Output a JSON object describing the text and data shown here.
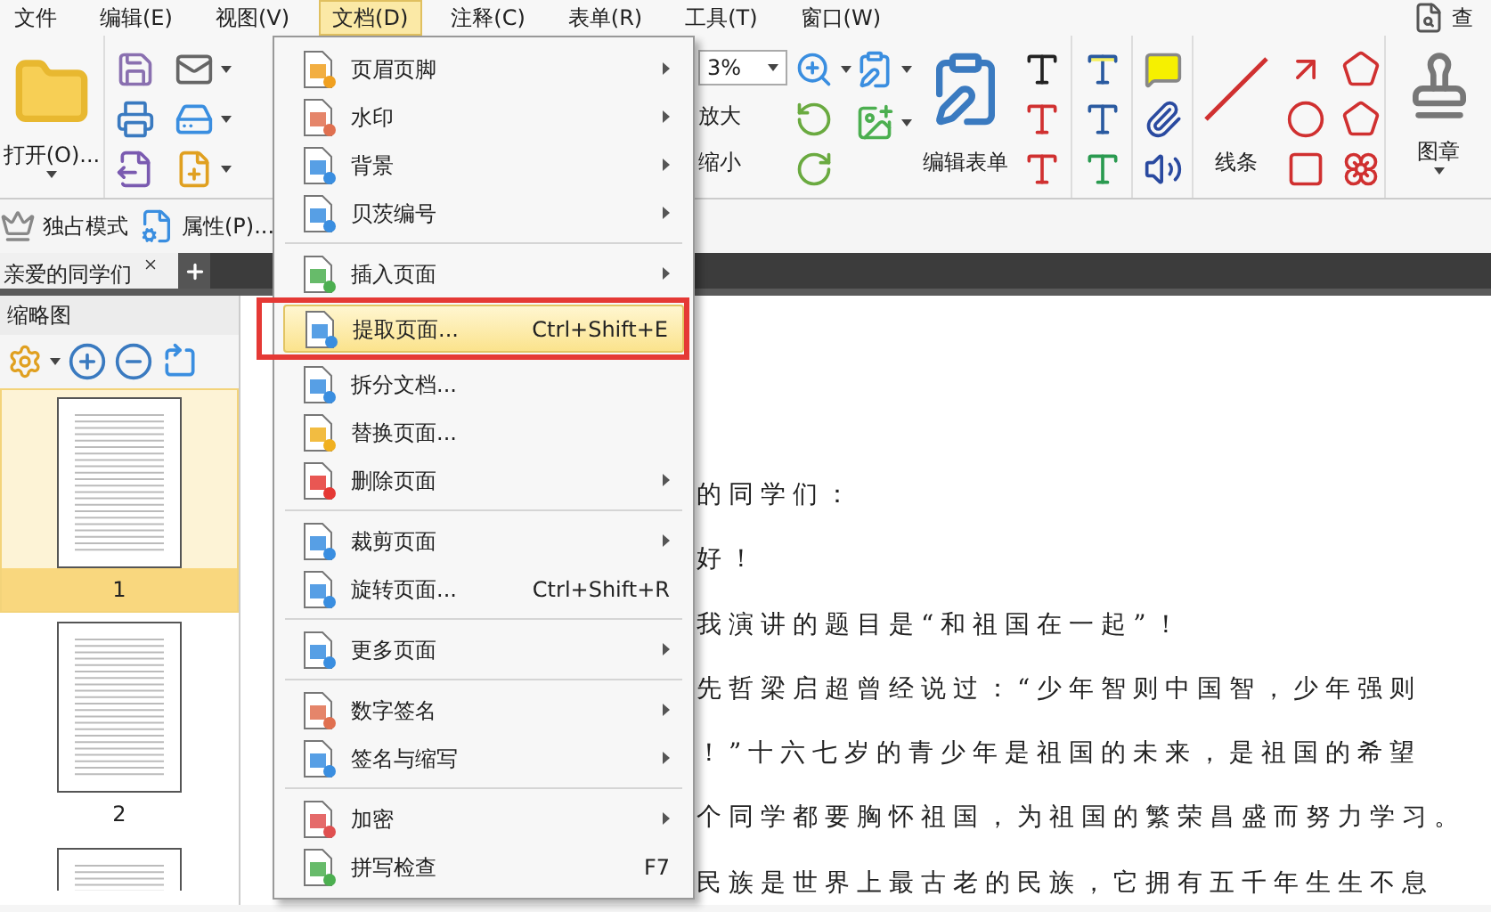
{
  "menu_bar": [
    {
      "label": "文件",
      "selected": false
    },
    {
      "label": "编辑(E)",
      "selected": false
    },
    {
      "label": "视图(V)",
      "selected": false
    },
    {
      "label": "文档(D)",
      "selected": true
    },
    {
      "label": "注释(C)",
      "selected": false
    },
    {
      "label": "表单(R)",
      "selected": false
    },
    {
      "label": "工具(T)",
      "selected": false
    },
    {
      "label": "窗口(W)",
      "selected": false
    }
  ],
  "find": {
    "label": "查"
  },
  "ribbon": {
    "open_label": "打开(O)...",
    "zoom_value": "3%",
    "zoom_in": "放大",
    "zoom_out": "缩小",
    "edit_form": "编辑表单",
    "line": "线条",
    "stamp": "图章"
  },
  "quick_bar": [
    {
      "label": "独占模式"
    },
    {
      "label": "属性(P)..."
    }
  ],
  "tabs": [
    {
      "label": "亲爱的同学们",
      "selected": true
    }
  ],
  "thumbnail_panel": {
    "title": "缩略图",
    "pages": [
      {
        "label": "1",
        "selected": true
      },
      {
        "label": "2",
        "selected": false
      }
    ],
    "partial_page": true
  },
  "document": {
    "lines": [
      "的同学们：",
      "好！",
      "我演讲的题目是“和祖国在一起”！",
      "先哲梁启超曾经说过：“少年智则中国智，少年强则",
      "！”十六七岁的青少年是祖国的未来，是祖国的希望",
      "个同学都要胸怀祖国，为祖国的繁荣昌盛而努力学习。",
      "民族是世界上最古老的民族，它拥有五千年生生不息"
    ]
  },
  "menu": {
    "groups": [
      {
        "items": [
          {
            "label": "页眉页脚",
            "submenu": true,
            "selected": false,
            "outlined": false
          },
          {
            "label": "水印",
            "submenu": true,
            "selected": false,
            "outlined": false
          },
          {
            "label": "背景",
            "submenu": true,
            "selected": false,
            "outlined": false
          },
          {
            "label": "贝茨编号",
            "submenu": true,
            "selected": false,
            "outlined": false
          }
        ]
      },
      {
        "items": [
          {
            "label": "插入页面",
            "submenu": true,
            "selected": false,
            "outlined": false
          },
          {
            "label": "提取页面...",
            "shortcut": "Ctrl+Shift+E",
            "submenu": false,
            "selected": true,
            "outlined": true
          },
          {
            "label": "拆分文档...",
            "submenu": false,
            "selected": false,
            "outlined": false
          },
          {
            "label": "替换页面...",
            "submenu": false,
            "selected": false,
            "outlined": false
          },
          {
            "label": "删除页面",
            "submenu": true,
            "selected": false,
            "outlined": false
          }
        ]
      },
      {
        "items": [
          {
            "label": "裁剪页面",
            "submenu": true,
            "selected": false,
            "outlined": false
          },
          {
            "label": "旋转页面...",
            "shortcut": "Ctrl+Shift+R",
            "submenu": false,
            "selected": false,
            "outlined": false
          }
        ]
      },
      {
        "items": [
          {
            "label": "更多页面",
            "submenu": true,
            "selected": false,
            "outlined": false
          }
        ]
      },
      {
        "items": [
          {
            "label": "数字签名",
            "submenu": true,
            "selected": false,
            "outlined": false
          },
          {
            "label": "签名与缩写",
            "submenu": true,
            "selected": false,
            "outlined": false
          }
        ]
      },
      {
        "items": [
          {
            "label": "加密",
            "submenu": true,
            "selected": false,
            "outlined": false
          },
          {
            "label": "拼写检查",
            "shortcut": "F7",
            "submenu": false,
            "selected": false,
            "outlined": false
          }
        ]
      }
    ]
  }
}
